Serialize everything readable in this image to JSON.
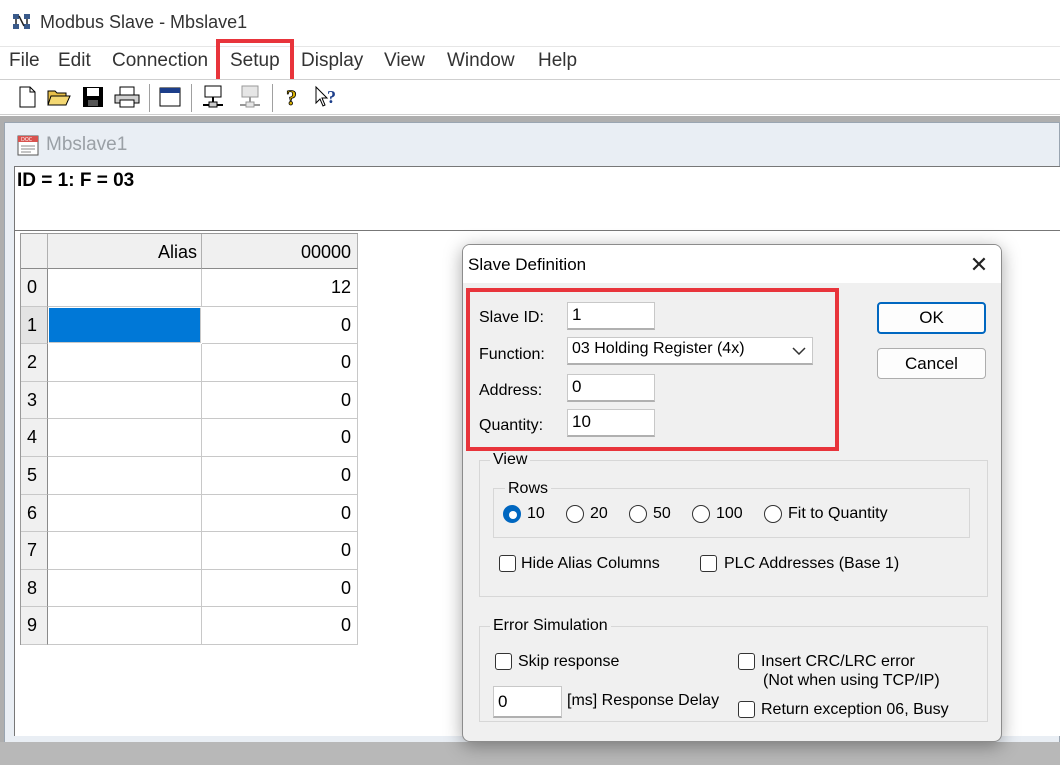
{
  "window": {
    "title": "Modbus Slave - Mbslave1"
  },
  "menu": {
    "items": [
      "File",
      "Edit",
      "Connection",
      "Setup",
      "Display",
      "View",
      "Window",
      "Help"
    ],
    "highlighted": "Setup"
  },
  "toolbar": {
    "buttons": [
      "new-document-icon",
      "open-folder-icon",
      "save-icon",
      "print-icon",
      "window-icon",
      "connect-icon",
      "disconnect-icon",
      "help-icon",
      "context-help-icon"
    ]
  },
  "child_window": {
    "title": "Mbslave1",
    "header": "ID = 1: F = 03"
  },
  "grid": {
    "columns": [
      "Alias",
      "00000"
    ],
    "rows": [
      {
        "index": "0",
        "alias": "",
        "value": "12"
      },
      {
        "index": "1",
        "alias": "",
        "value": "0",
        "selected": true
      },
      {
        "index": "2",
        "alias": "",
        "value": "0"
      },
      {
        "index": "3",
        "alias": "",
        "value": "0"
      },
      {
        "index": "4",
        "alias": "",
        "value": "0"
      },
      {
        "index": "5",
        "alias": "",
        "value": "0"
      },
      {
        "index": "6",
        "alias": "",
        "value": "0"
      },
      {
        "index": "7",
        "alias": "",
        "value": "0"
      },
      {
        "index": "8",
        "alias": "",
        "value": "0"
      },
      {
        "index": "9",
        "alias": "",
        "value": "0"
      }
    ]
  },
  "dialog": {
    "title": "Slave Definition",
    "close_glyph": "✕",
    "slave_id_label": "Slave ID:",
    "slave_id_value": "1",
    "function_label": "Function:",
    "function_value": "03 Holding Register (4x)",
    "address_label": "Address:",
    "address_value": "0",
    "quantity_label": "Quantity:",
    "quantity_value": "10",
    "ok_label": "OK",
    "cancel_label": "Cancel",
    "view_group": "View",
    "rows_group": "Rows",
    "rows_options": [
      "10",
      "20",
      "50",
      "100",
      "Fit to Quantity"
    ],
    "rows_selected": "10",
    "hide_alias_label": "Hide Alias Columns",
    "plc_addresses_label": "PLC Addresses (Base 1)",
    "error_group": "Error Simulation",
    "skip_response_label": "Skip response",
    "response_delay_value": "0",
    "response_delay_label": "[ms] Response Delay",
    "insert_crc_label": "Insert CRC/LRC error",
    "insert_crc_note": "(Not when using TCP/IP)",
    "return_exception_label": "Return exception 06, Busy"
  },
  "colors": {
    "highlight_red": "#e8343b",
    "selection_blue": "#0078d7",
    "accent_blue": "#0067c0"
  }
}
